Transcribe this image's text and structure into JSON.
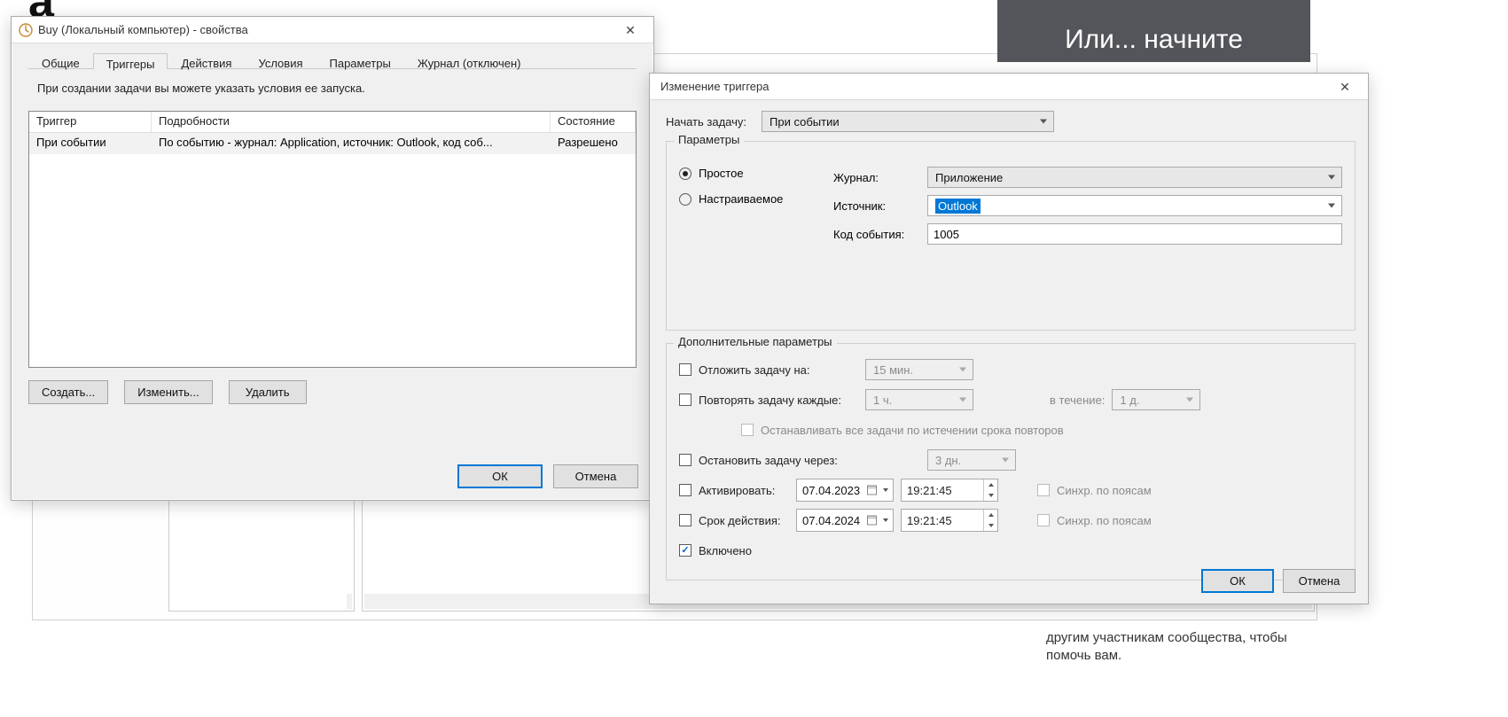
{
  "background": {
    "letter": "a",
    "banner": "Или... начните",
    "help": "другим участникам сообщества, чтобы помочь вам."
  },
  "dlg1": {
    "title": "Buy (Локальный компьютер) - свойства",
    "tabs": {
      "general": "Общие",
      "triggers": "Триггеры",
      "actions": "Действия",
      "conditions": "Условия",
      "settings": "Параметры",
      "history": "Журнал (отключен)"
    },
    "hint": "При создании задачи вы можете указать условия ее запуска.",
    "cols": {
      "trigger": "Триггер",
      "details": "Подробности",
      "state": "Состояние"
    },
    "row": {
      "trigger": "При событии",
      "details": "По событию - журнал: Application, источник: Outlook, код соб...",
      "state": "Разрешено"
    },
    "buttons": {
      "create": "Создать...",
      "edit": "Изменить...",
      "delete": "Удалить"
    },
    "footer": {
      "ok": "ОК",
      "cancel": "Отмена"
    }
  },
  "dlg2": {
    "title": "Изменение триггера",
    "begin_label": "Начать задачу:",
    "begin_value": "При событии",
    "params_legend": "Параметры",
    "radio_simple": "Простое",
    "radio_custom": "Настраиваемое",
    "log_label": "Журнал:",
    "log_value": "Приложение",
    "source_label": "Источник:",
    "source_value": "Outlook",
    "eventid_label": "Код события:",
    "eventid_value": "1005",
    "adv_legend": "Дополнительные параметры",
    "adv": {
      "delay": "Отложить задачу на:",
      "delay_val": "15 мин.",
      "repeat": "Повторять задачу каждые:",
      "repeat_val": "1 ч.",
      "for_label": "в течение:",
      "for_val": "1 д.",
      "stop_all": "Останавливать все задачи по истечении срока повторов",
      "stop": "Остановить задачу через:",
      "stop_val": "3 дн.",
      "activate": "Активировать:",
      "act_date": "07.04.2023",
      "act_time": "19:21:45",
      "sync": "Синхр. по поясам",
      "expire": "Срок действия:",
      "exp_date": "07.04.2024",
      "exp_time": "19:21:45",
      "enabled": "Включено"
    },
    "footer": {
      "ok": "ОК",
      "cancel": "Отмена"
    }
  }
}
